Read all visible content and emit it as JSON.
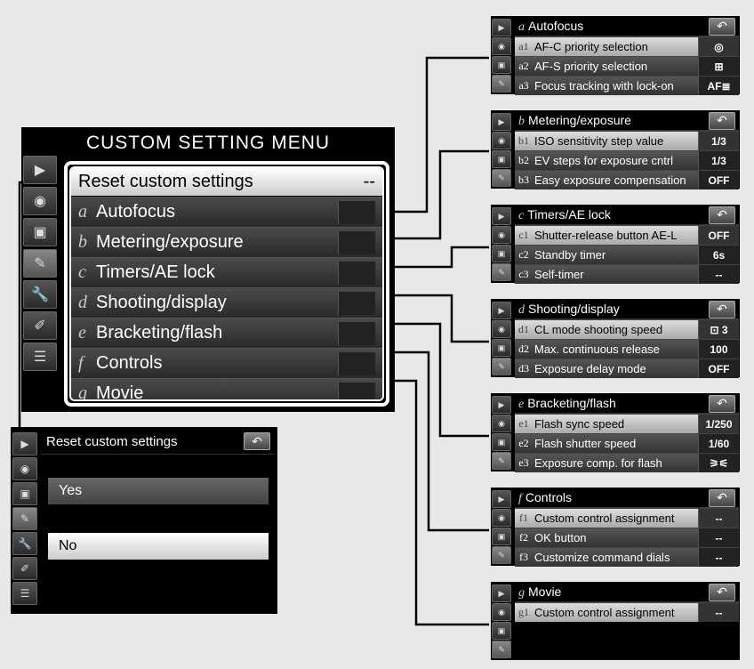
{
  "main": {
    "title": "CUSTOM SETTING MENU",
    "reset_label": "Reset custom settings",
    "reset_value": "--",
    "items": [
      {
        "letter": "a",
        "label": "Autofocus"
      },
      {
        "letter": "b",
        "label": "Metering/exposure"
      },
      {
        "letter": "c",
        "label": "Timers/AE lock"
      },
      {
        "letter": "d",
        "label": "Shooting/display"
      },
      {
        "letter": "e",
        "label": "Bracketing/flash"
      },
      {
        "letter": "f",
        "label": "Controls"
      },
      {
        "letter": "g",
        "label": "Movie"
      }
    ]
  },
  "reset_confirm": {
    "title": "Reset custom settings",
    "yes": "Yes",
    "no": "No"
  },
  "submenus": [
    {
      "letter": "a",
      "title": "Autofocus",
      "rows": [
        {
          "code": "a1",
          "label": "AF-C priority selection",
          "value": "◎",
          "hi": true
        },
        {
          "code": "a2",
          "label": "AF-S priority selection",
          "value": "⊞"
        },
        {
          "code": "a3",
          "label": "Focus tracking with lock-on",
          "value": "AF≣"
        }
      ]
    },
    {
      "letter": "b",
      "title": "Metering/exposure",
      "rows": [
        {
          "code": "b1",
          "label": "ISO sensitivity step value",
          "value": "1/3",
          "hi": true
        },
        {
          "code": "b2",
          "label": "EV steps for exposure cntrl",
          "value": "1/3"
        },
        {
          "code": "b3",
          "label": "Easy exposure compensation",
          "value": "OFF"
        }
      ]
    },
    {
      "letter": "c",
      "title": "Timers/AE lock",
      "rows": [
        {
          "code": "c1",
          "label": "Shutter-release button AE-L",
          "value": "OFF",
          "hi": true
        },
        {
          "code": "c2",
          "label": "Standby timer",
          "value": "6s"
        },
        {
          "code": "c3",
          "label": "Self-timer",
          "value": "--"
        }
      ]
    },
    {
      "letter": "d",
      "title": "Shooting/display",
      "rows": [
        {
          "code": "d1",
          "label": "CL mode shooting speed",
          "value": "⊡ 3",
          "hi": true
        },
        {
          "code": "d2",
          "label": "Max. continuous release",
          "value": "100"
        },
        {
          "code": "d3",
          "label": "Exposure delay mode",
          "value": "OFF"
        }
      ]
    },
    {
      "letter": "e",
      "title": "Bracketing/flash",
      "rows": [
        {
          "code": "e1",
          "label": "Flash sync speed",
          "value": "1/250",
          "hi": true
        },
        {
          "code": "e2",
          "label": "Flash shutter speed",
          "value": "1/60"
        },
        {
          "code": "e3",
          "label": "Exposure comp. for flash",
          "value": "⚞⚟"
        }
      ]
    },
    {
      "letter": "f",
      "title": "Controls",
      "rows": [
        {
          "code": "f1",
          "label": "Custom control assignment",
          "value": "--",
          "hi": true
        },
        {
          "code": "f2",
          "label": "OK button",
          "value": "--"
        },
        {
          "code": "f3",
          "label": "Customize command dials",
          "value": "--"
        }
      ]
    },
    {
      "letter": "g",
      "title": "Movie",
      "rows": [
        {
          "code": "g1",
          "label": "Custom control assignment",
          "value": "--",
          "hi": true
        }
      ]
    }
  ],
  "icons": {
    "back": "↶",
    "play": "▶",
    "camera": "◉",
    "movie": "▣",
    "pencil": "✎",
    "wrench": "🔧",
    "retouch": "✐",
    "list": "☰"
  }
}
